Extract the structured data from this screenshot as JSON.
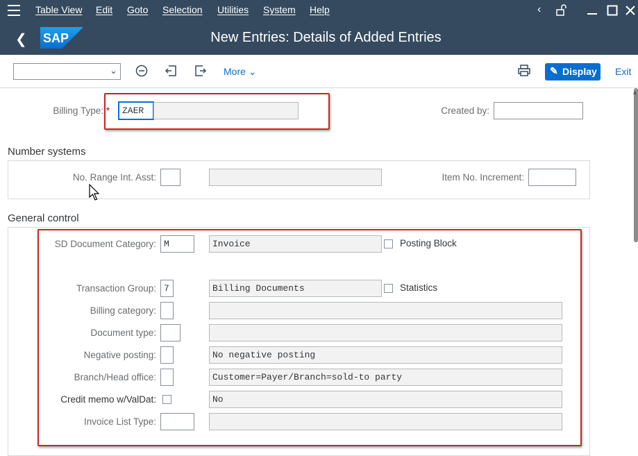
{
  "menubar": {
    "items": [
      "Table View",
      "Edit",
      "Goto",
      "Selection",
      "Utilities",
      "System",
      "Help"
    ],
    "icons": [
      "menu-icon",
      "chevron-left-icon",
      "unlock-icon",
      "minimize-icon",
      "maximize-icon",
      "close-icon"
    ]
  },
  "header": {
    "title": "New Entries: Details of Added Entries",
    "logo_text": "SAP"
  },
  "toolbar": {
    "select_value": "",
    "more_label": "More",
    "display_label": "Display",
    "exit_label": "Exit"
  },
  "top_fields": {
    "billing_type_label": "Billing Type:",
    "required_marker": "*",
    "billing_type_value": "ZAER",
    "billing_type_desc": "",
    "created_by_label": "Created by:",
    "created_by_value": ""
  },
  "number_systems": {
    "title": "Number systems",
    "no_range_label": "No. Range Int. Asst:",
    "no_range_value": "",
    "no_range_desc": "",
    "item_no_label": "Item No. Increment:",
    "item_no_value": ""
  },
  "general_control": {
    "title": "General control",
    "rows": [
      {
        "label": "SD Document Category:",
        "value": "M",
        "desc": "Invoice"
      },
      {
        "label": "Transaction Group:",
        "value": "7",
        "desc": "Billing Documents"
      },
      {
        "label": "Billing category:",
        "value": "",
        "desc": ""
      },
      {
        "label": "Document type:",
        "value": "",
        "desc": ""
      },
      {
        "label": "Negative posting:",
        "value": "",
        "desc": "No negative posting"
      },
      {
        "label": "Branch/Head office:",
        "value": "",
        "desc": "Customer=Payer/Branch=sold-to party"
      },
      {
        "label": "Credit memo w/ValDat:",
        "value": "",
        "desc": "No"
      },
      {
        "label": "Invoice List Type:",
        "value": "",
        "desc": ""
      }
    ],
    "posting_block_label": "Posting Block",
    "statistics_label": "Statistics"
  },
  "colors": {
    "shell": "#354a5f",
    "accent": "#0a6ed1",
    "highlight": "#cc2222"
  }
}
